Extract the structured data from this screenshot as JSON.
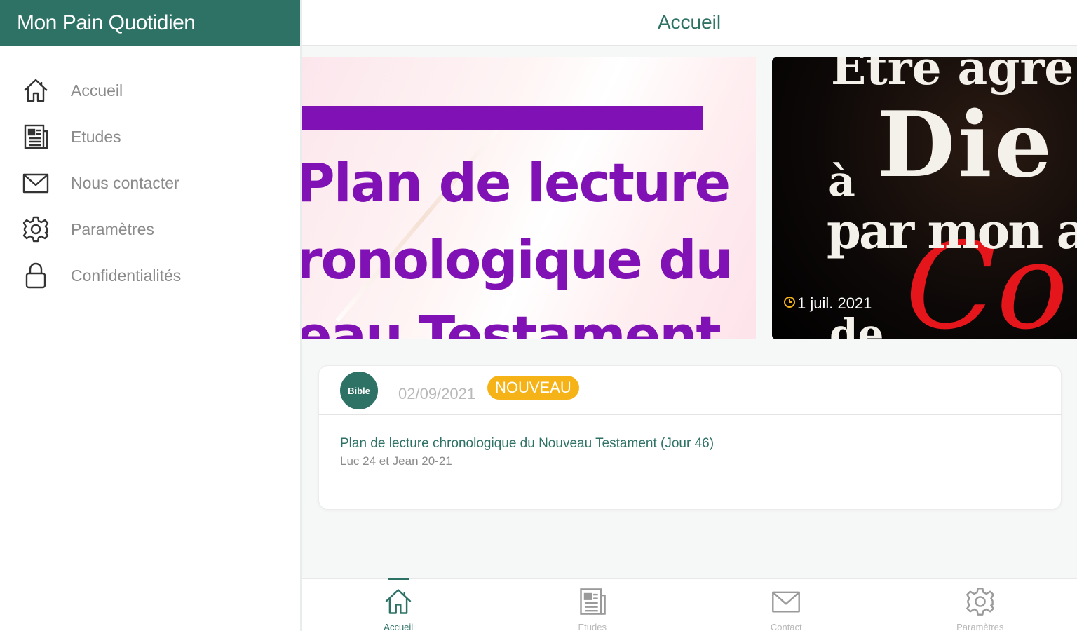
{
  "app": {
    "title": "Mon Pain Quotidien",
    "accent_color": "#2e7266"
  },
  "sidebar": {
    "items": [
      {
        "label": "Accueil",
        "icon": "home-icon"
      },
      {
        "label": "Etudes",
        "icon": "newspaper-icon"
      },
      {
        "label": "Nous contacter",
        "icon": "mail-icon"
      },
      {
        "label": "Paramètres",
        "icon": "gear-icon"
      },
      {
        "label": "Confidentialités",
        "icon": "lock-icon"
      }
    ]
  },
  "header": {
    "title": "Accueil"
  },
  "carousel": {
    "slides": [
      {
        "lines": [
          "Plan de lecture",
          "ronologique du",
          "eau Testament"
        ],
        "accent": "#8012b5"
      },
      {
        "lines": [
          "Etre agré",
          "à",
          "Die",
          "par mon a",
          "de",
          "Co"
        ],
        "date": "1 juil. 2021",
        "date_icon": "clock-icon"
      }
    ]
  },
  "card": {
    "avatar_text": "Bible",
    "date": "02/09/2021",
    "badge": "NOUVEAU",
    "badge_color": "#f5b318",
    "title": "Plan de lecture chronologique du Nouveau Testament (Jour 46)",
    "subtitle": "Luc 24 et Jean 20-21"
  },
  "bottom_nav": {
    "items": [
      {
        "label": "Accueil",
        "icon": "home-icon",
        "active": true
      },
      {
        "label": "Etudes",
        "icon": "newspaper-icon",
        "active": false
      },
      {
        "label": "Contact",
        "icon": "mail-icon",
        "active": false
      },
      {
        "label": "Paramètres",
        "icon": "gear-icon",
        "active": false
      }
    ]
  }
}
